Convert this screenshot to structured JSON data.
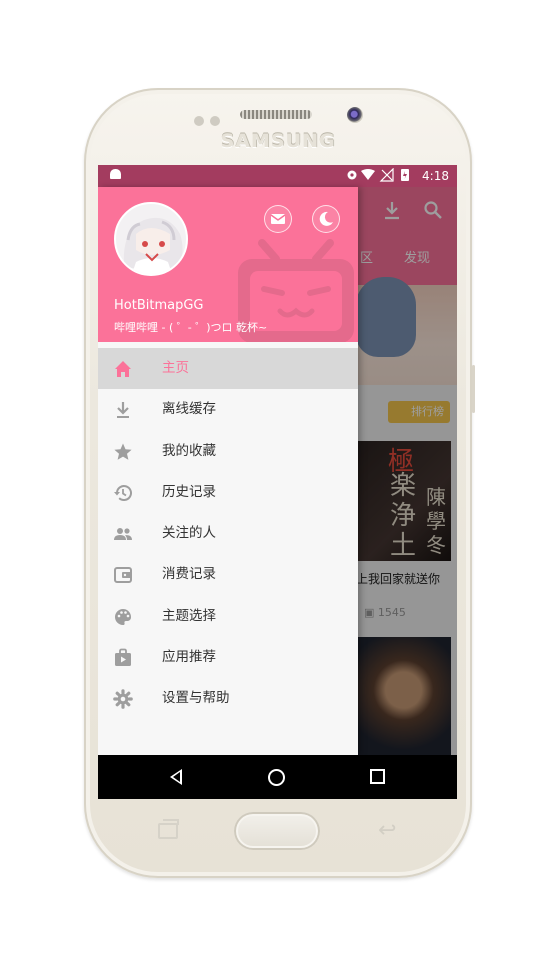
{
  "device": {
    "brand": "SAMSUNG"
  },
  "status_bar": {
    "time": "4:18"
  },
  "background_app": {
    "tabs": [
      "区",
      "发现"
    ],
    "rank_badge": "排行榜",
    "card_title": "上我回家就送你",
    "card_views": "1545",
    "poster_text": "極楽浄土",
    "poster_text_right": "陳學冬"
  },
  "drawer": {
    "username": "HotBitmapGG",
    "signature": "哔哩哔哩 - ( ゜- ゜)つロ 乾杯~",
    "items": [
      {
        "label": "主页",
        "icon": "home-icon",
        "selected": true
      },
      {
        "label": "离线缓存",
        "icon": "download-icon",
        "selected": false
      },
      {
        "label": "我的收藏",
        "icon": "star-icon",
        "selected": false
      },
      {
        "label": "历史记录",
        "icon": "history-icon",
        "selected": false
      },
      {
        "label": "关注的人",
        "icon": "people-icon",
        "selected": false
      },
      {
        "label": "消费记录",
        "icon": "wallet-icon",
        "selected": false
      },
      {
        "label": "主题选择",
        "icon": "palette-icon",
        "selected": false
      },
      {
        "label": "应用推荐",
        "icon": "app-store-icon",
        "selected": false
      },
      {
        "label": "设置与帮助",
        "icon": "gear-icon",
        "selected": false
      }
    ]
  },
  "colors": {
    "accent": "#fb7299",
    "status_bar": "#a33c5f",
    "selected_row": "#d8d8d8",
    "icon_gray": "#9e9e9e"
  }
}
